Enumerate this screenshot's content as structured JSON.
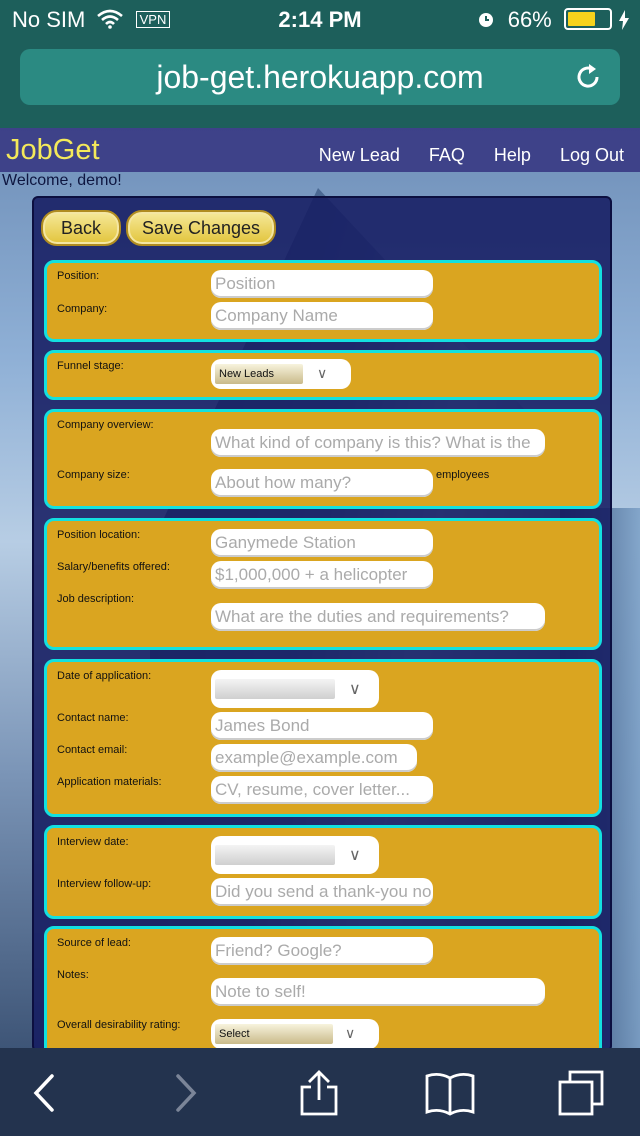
{
  "status": {
    "carrier": "No SIM",
    "vpn": "VPN",
    "time": "2:14 PM",
    "battery": "66%"
  },
  "browser": {
    "url": "job-get.herokuapp.com"
  },
  "site": {
    "logo": "JobGet",
    "nav": [
      "New Lead",
      "FAQ",
      "Help",
      "Log Out"
    ],
    "welcome": "Welcome, demo!"
  },
  "actions": {
    "back": "Back",
    "save": "Save Changes"
  },
  "form": {
    "position_label": "Position:",
    "position_ph": "Position",
    "company_label": "Company:",
    "company_ph": "Company Name",
    "funnel_label": "Funnel stage:",
    "funnel_value": "New Leads",
    "overview_label": "Company overview:",
    "overview_ph": "What kind of company is this? What is the",
    "size_label": "Company size:",
    "size_ph": "About how many?",
    "size_suffix": "employees",
    "location_label": "Position location:",
    "location_ph": "Ganymede Station",
    "salary_label": "Salary/benefits offered:",
    "salary_ph": "$1,000,000 + a helicopter",
    "jobdesc_label": "Job description:",
    "jobdesc_ph": "What are the duties and requirements?",
    "appdate_label": "Date of application:",
    "contact_label": "Contact name:",
    "contact_ph": "James Bond",
    "email_label": "Contact email:",
    "email_ph": "example@example.com",
    "materials_label": "Application materials:",
    "materials_ph": "CV, resume, cover letter...",
    "interview_label": "Interview date:",
    "followup_label": "Interview follow-up:",
    "followup_ph": "Did you send a thank-you no",
    "source_label": "Source of lead:",
    "source_ph": "Friend? Google?",
    "notes_label": "Notes:",
    "notes_ph": "Note to self!",
    "rating_label": "Overall desirability rating:",
    "rating_value": "Select"
  },
  "icons": [
    "wifi-icon",
    "alarm-icon",
    "charging-icon",
    "reload-icon",
    "back-icon",
    "forward-icon",
    "share-icon",
    "bookmarks-icon",
    "tabs-icon"
  ]
}
